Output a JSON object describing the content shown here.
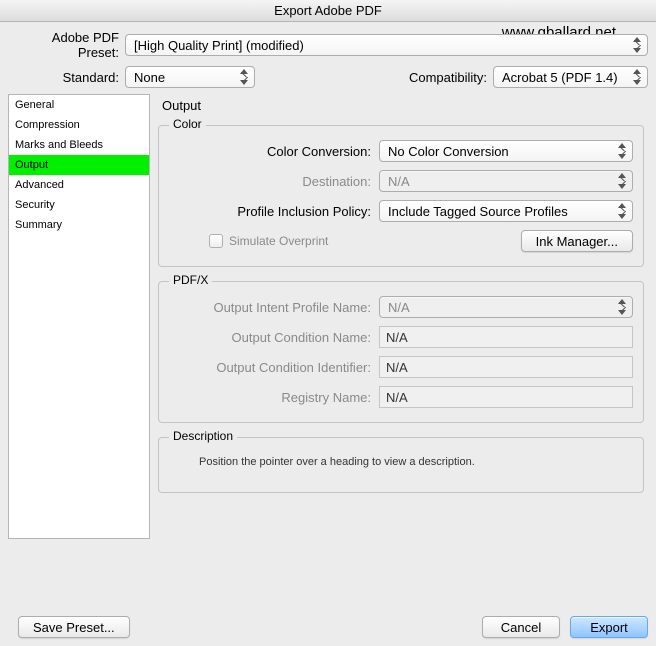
{
  "window": {
    "title": "Export Adobe PDF"
  },
  "watermark": "www.gballard.net",
  "top": {
    "preset_label": "Adobe PDF Preset:",
    "preset_value": "[High Quality Print] (modified)",
    "standard_label": "Standard:",
    "standard_value": "None",
    "compat_label": "Compatibility:",
    "compat_value": "Acrobat 5 (PDF 1.4)"
  },
  "sidebar": {
    "items": [
      {
        "label": "General"
      },
      {
        "label": "Compression"
      },
      {
        "label": "Marks and Bleeds"
      },
      {
        "label": "Output"
      },
      {
        "label": "Advanced"
      },
      {
        "label": "Security"
      },
      {
        "label": "Summary"
      }
    ],
    "selected_index": 3
  },
  "panel": {
    "title": "Output",
    "color": {
      "legend": "Color",
      "color_conversion_label": "Color Conversion:",
      "color_conversion_value": "No Color Conversion",
      "destination_label": "Destination:",
      "destination_value": "N/A",
      "profile_label": "Profile Inclusion Policy:",
      "profile_value": "Include Tagged Source Profiles",
      "simulate_label": "Simulate Overprint",
      "ink_manager_label": "Ink Manager..."
    },
    "pdfx": {
      "legend": "PDF/X",
      "intent_label": "Output Intent Profile Name:",
      "intent_value": "N/A",
      "cond_name_label": "Output Condition Name:",
      "cond_name_value": "N/A",
      "cond_id_label": "Output Condition Identifier:",
      "cond_id_value": "N/A",
      "registry_label": "Registry Name:",
      "registry_value": "N/A"
    },
    "description": {
      "legend": "Description",
      "text": "Position the pointer over a heading to view a description."
    }
  },
  "footer": {
    "save_preset": "Save Preset...",
    "cancel": "Cancel",
    "export": "Export"
  }
}
